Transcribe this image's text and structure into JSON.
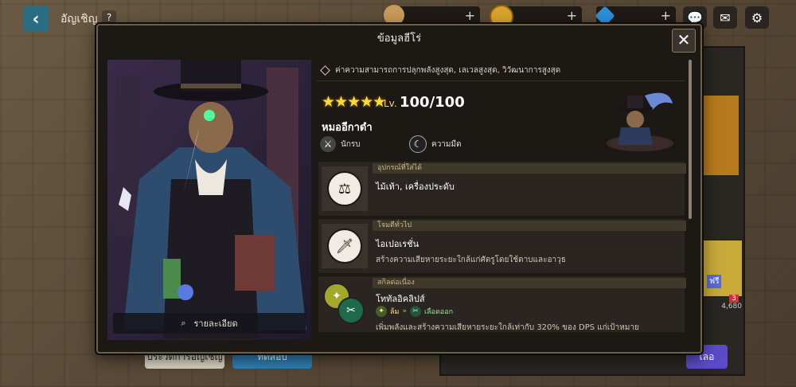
{
  "top_bar": {
    "title": "อัญเชิญ",
    "help": "?",
    "resources": [
      {
        "name": "coffee-resource",
        "plus": "+"
      },
      {
        "name": "gold-resource",
        "plus": "+"
      },
      {
        "name": "gem-resource",
        "plus": "+"
      }
    ]
  },
  "background": {
    "history_button": "ประวัติการอัญเชิญ",
    "test_button": "ทดสอบ",
    "right_button": "เลอ",
    "badge_count": "3",
    "free_label": "ฟรี",
    "cost": "4,680"
  },
  "modal": {
    "title": "ข้อมูลฮีโร่",
    "close": "✕",
    "detail_label": "รายละเอียด",
    "hint": "ค่าความสามารถการปลุกพลังสูงสุด, เลเวลสูงสุด, วิวัฒนาการสูงสุด",
    "stars": "★★★★★",
    "level_label": "Lv.",
    "level_value": "100/100",
    "hero_name": "หมออีกาดำ",
    "traits": [
      {
        "icon": "crossed-swords-icon",
        "label": "นักรบ"
      },
      {
        "icon": "dark-moon-icon",
        "label": "ความมืด"
      }
    ],
    "cards": [
      {
        "header": "อุปกรณ์ที่ใส่ได้",
        "name": "ไม้เท้า, เครื่องประดับ",
        "desc": ""
      },
      {
        "header": "โจมตีทั่วไป",
        "name": "ไอเปอเรชั่น",
        "desc": "สร้างความเสียหายระยะใกล้แก่ศัตรูโดยใช้ดาบและอาวุธ"
      },
      {
        "header": "สกิลต่อเนื่อง",
        "name": "โททัลอิคลิปส์",
        "tag1": "ล้ม",
        "tag2": "เลือดออก",
        "desc": "เพิ่มพลังและสร้างความเสียหายระยะใกล้เท่ากับ 320% ของ DPS แก่เป้าหมาย"
      }
    ]
  },
  "colors": {
    "accent_gold": "#ffd83a",
    "panel_bg": "#1c1915",
    "border": "#6e5f49"
  }
}
